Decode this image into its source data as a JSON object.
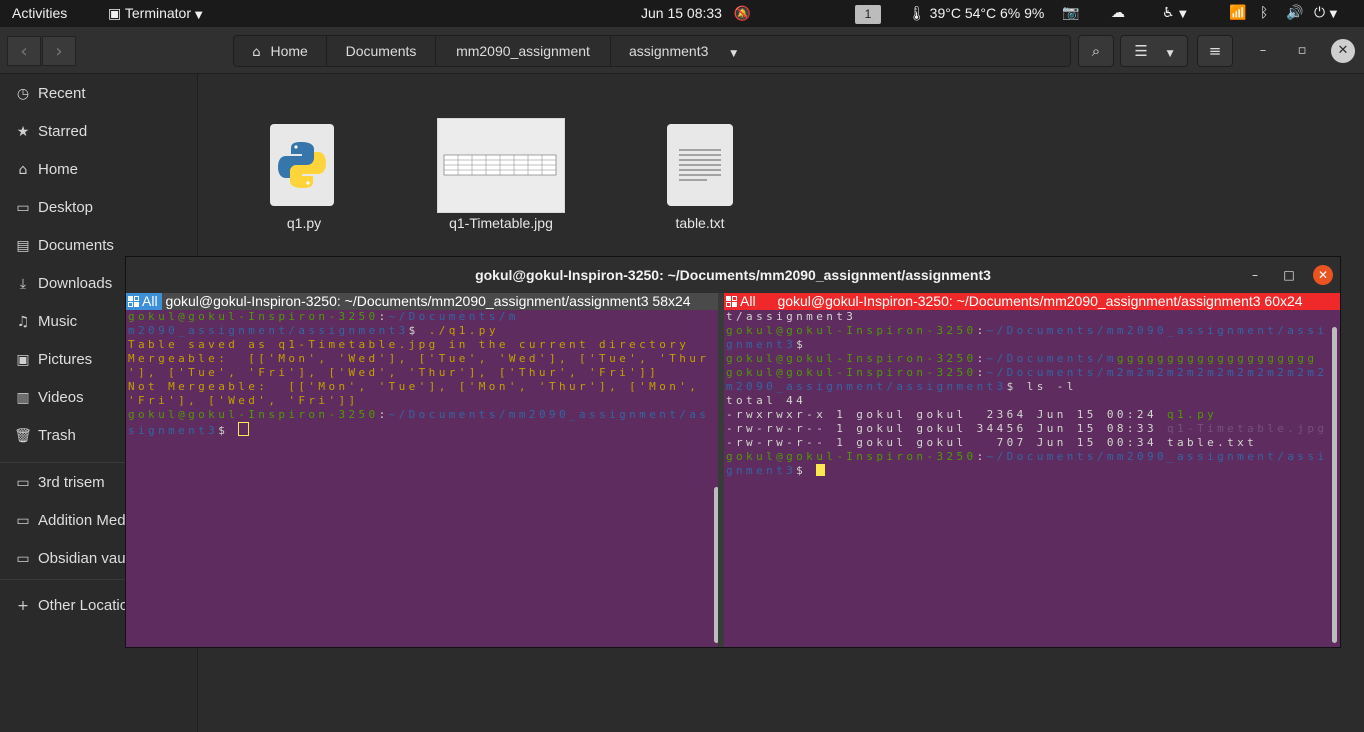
{
  "topbar": {
    "activities": "Activities",
    "app_name": "Terminator",
    "clock": "Jun 15  08:33",
    "workspace": "1",
    "sensors": "39°C 54°C 6% 9%"
  },
  "files": {
    "breadcrumbs": [
      "Home",
      "Documents",
      "mm2090_assignment",
      "assignment3"
    ],
    "sidebar": {
      "places": [
        "Recent",
        "Starred",
        "Home",
        "Desktop",
        "Documents",
        "Downloads",
        "Music",
        "Pictures",
        "Videos",
        "Trash"
      ],
      "mounts": [
        "3rd trisem",
        "Addition Media",
        "Obsidian vault"
      ],
      "other": "Other Locations"
    },
    "items": [
      {
        "name": "q1.py",
        "icon": "python-file-icon"
      },
      {
        "name": "q1-Timetable.jpg",
        "icon": "image-thumbnail"
      },
      {
        "name": "table.txt",
        "icon": "text-file-icon"
      }
    ]
  },
  "terminal": {
    "window_title": "gokul@gokul-Inspiron-3250: ~/Documents/mm2090_assignment/assignment3",
    "left_pane": {
      "badge": "All",
      "title": "gokul@gokul-Inspiron-3250: ~/Documents/mm2090_assignment/assignment3 58x24",
      "prompt_user": "gokul@gokul-Inspiron-3250",
      "prompt_path_a": "~/Documents/m",
      "prompt_path_b": "m2090_assignment/assignment3",
      "cmd1": "./q1.py",
      "out1": "Table saved as q1-Timetable.jpg in the current directory",
      "out2": "Mergeable:  [['Mon', 'Wed'], ['Tue', 'Wed'], ['Tue', 'Thur",
      "out3": "'], ['Tue', 'Fri'], ['Wed', 'Thur'], ['Thur', 'Fri']]",
      "out4": "Not Mergeable:  [['Mon', 'Tue'], ['Mon', 'Thur'], ['Mon',",
      "out5": "'Fri'], ['Wed', 'Fri']]",
      "prompt2_path_a": "~/Documents/mm2090_assignment/as",
      "prompt2_path_b": "signment3"
    },
    "right_pane": {
      "badge": "All",
      "title": "gokul@gokul-Inspiron-3250: ~/Documents/mm2090_assignment/assignment3 60x24",
      "line1": "t/assignment3",
      "line2_user": "gokul@gokul-Inspiron-3250",
      "line2_path": "~/Documents/mm2090_assignment/assi",
      "line3": "gnment3",
      "line4_user": "gokul@gokul-Inspiron-3250",
      "line4_path_a": "~/Documents/m",
      "line4_garbled": "gggggggggggggggggggg",
      "line5_user": "gokul@gokul-Inspiron-3250",
      "line5_path": "~/Documents/m2m2m2m2m2m2m2m2m2m2m2",
      "line6_path": "m2090_assignment/assignment3",
      "line6_cmd": "ls -l",
      "total": "total 44",
      "ls_rows": [
        {
          "meta": "-rwxrwxr-x 1 gokul gokul  2364 Jun 15 00:24 ",
          "name": "q1.py",
          "kind": "exec"
        },
        {
          "meta": "-rw-rw-r-- 1 gokul gokul 34456 Jun 15 08:33 ",
          "name": "q1-Timetable.jpg",
          "kind": "image"
        },
        {
          "meta": "-rw-rw-r-- 1 gokul gokul   707 Jun 15 00:34 ",
          "name": "table.txt",
          "kind": "plain"
        }
      ],
      "line10_user": "gokul@gokul-Inspiron-3250",
      "line10_path": "~/Documents/mm2090_assignment/assi",
      "line11": "gnment3"
    }
  },
  "colors": {
    "terminal_bg": "#5e2c5e",
    "prompt_user": "#4e9a06",
    "prompt_path": "#3465a4",
    "output_text": "#c4a000",
    "active_pane_header": "#ef2929",
    "inactive_pane_badge": "#3d8fd8",
    "close_button": "#e95420"
  }
}
